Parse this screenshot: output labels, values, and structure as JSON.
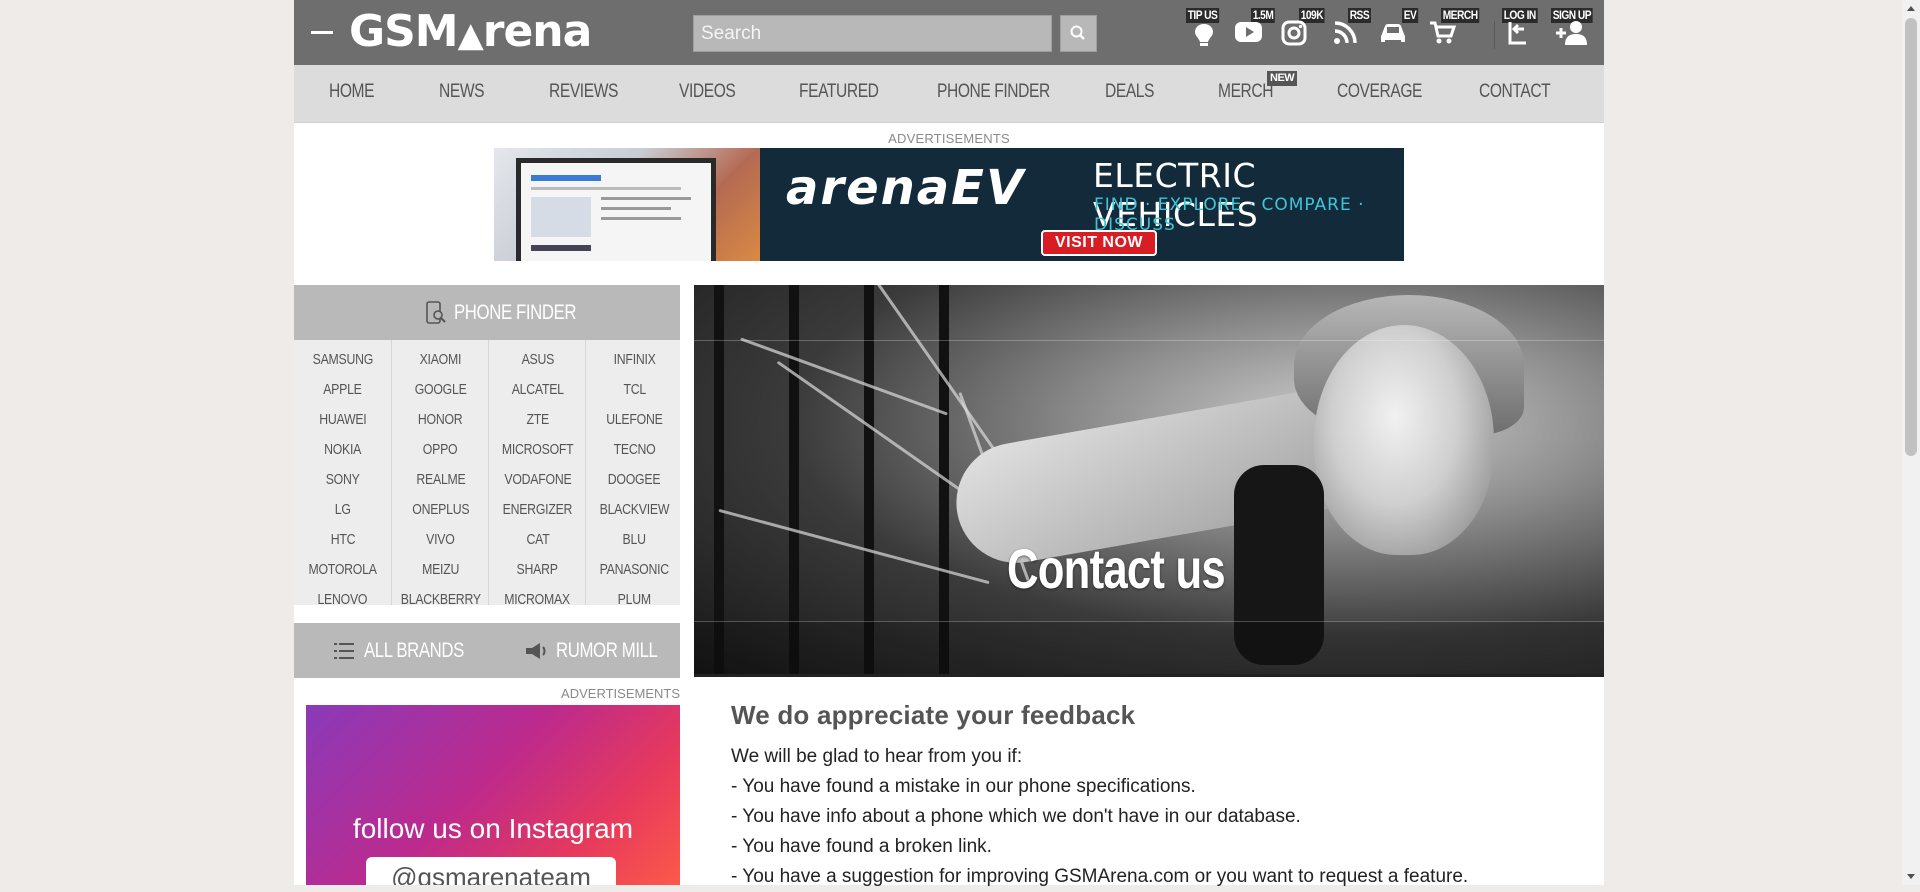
{
  "header": {
    "logo_text": "GSMArena",
    "search_placeholder": "Search",
    "top_links": [
      {
        "label": "TIP US",
        "icon": "lightbulb-icon"
      },
      {
        "label": "1.5M",
        "icon": "youtube-icon"
      },
      {
        "label": "109K",
        "icon": "instagram-icon"
      },
      {
        "label": "RSS",
        "icon": "rss-icon"
      },
      {
        "label": "EV",
        "icon": "car-icon"
      },
      {
        "label": "MERCH",
        "icon": "cart-icon"
      },
      {
        "label": "LOG IN",
        "icon": "login-icon"
      },
      {
        "label": "SIGN UP",
        "icon": "add-user-icon"
      }
    ]
  },
  "nav": {
    "items": [
      "HOME",
      "NEWS",
      "REVIEWS",
      "VIDEOS",
      "FEATURED",
      "PHONE FINDER",
      "DEALS",
      "MERCH",
      "COVERAGE",
      "CONTACT"
    ],
    "new_badge": "NEW"
  },
  "ad": {
    "label": "ADVERTISEMENTS",
    "brand": "arenaEV",
    "title": "ELECTRIC VEHICLES",
    "subtitle": "FIND · EXPLORE · COMPARE · DISCUSS",
    "button": "VISIT NOW"
  },
  "sidebar": {
    "phone_finder": "PHONE FINDER",
    "brands": [
      [
        "SAMSUNG",
        "APPLE",
        "HUAWEI",
        "NOKIA",
        "SONY",
        "LG",
        "HTC",
        "MOTOROLA",
        "LENOVO"
      ],
      [
        "XIAOMI",
        "GOOGLE",
        "HONOR",
        "OPPO",
        "REALME",
        "ONEPLUS",
        "VIVO",
        "MEIZU",
        "BLACKBERRY"
      ],
      [
        "ASUS",
        "ALCATEL",
        "ZTE",
        "MICROSOFT",
        "VODAFONE",
        "ENERGIZER",
        "CAT",
        "SHARP",
        "MICROMAX"
      ],
      [
        "INFINIX",
        "TCL",
        "ULEFONE",
        "TECNO",
        "DOOGEE",
        "BLACKVIEW",
        "BLU",
        "PANASONIC",
        "PLUM"
      ]
    ],
    "all_brands": "ALL BRANDS",
    "rumor_mill": "RUMOR MILL",
    "ad_label": "ADVERTISEMENTS",
    "insta_text": "follow us on Instagram",
    "insta_handle": "@gsmarenateam"
  },
  "hero": {
    "title": "Contact us"
  },
  "article": {
    "heading": "We do appreciate your feedback",
    "intro": "We will be glad to hear from you if:",
    "lines": [
      "- You have found a mistake in our phone specifications.",
      "- You have info about a phone which we don't have in our database.",
      "- You have found a broken link.",
      "- You have a suggestion for improving GSMArena.com or you want to request a feature."
    ]
  }
}
